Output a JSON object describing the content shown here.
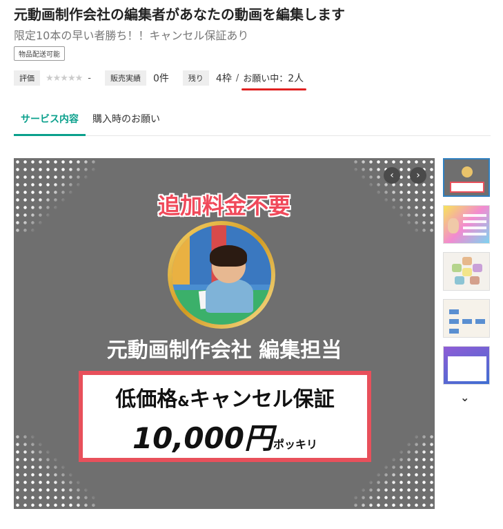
{
  "header": {
    "title": "元動画制作会社の編集者があなたの動画を編集します",
    "subtitle": "限定10本の早い者勝ち！！キャンセル保証あり",
    "badge": "物品配送可能"
  },
  "stats": {
    "rating_label": "評価",
    "rating_stars": "★★★★★",
    "rating_value": "-",
    "sales_label": "販売実績",
    "sales_value": "0件",
    "remaining_label": "残り",
    "remaining_value": "4枠",
    "slash": "/",
    "wish_label": "お願い中：",
    "wish_value": "2人"
  },
  "tabs": [
    {
      "label": "サービス内容",
      "active": true
    },
    {
      "label": "購入時のお願い",
      "active": false
    }
  ],
  "main_image": {
    "headline": "追加料金不要",
    "company_line": "元動画制作会社 編集担当",
    "offer_line1_a": "低価格",
    "offer_line1_amp": "&",
    "offer_line1_b": "キャンセル保証",
    "price": "10,000円",
    "price_suffix": "ポッキリ"
  },
  "carousel": {
    "prev_icon": "‹",
    "next_icon": "›",
    "thumbnail_count": 5,
    "more_icon": "⌄"
  },
  "colors": {
    "accent_green": "#0aa08c",
    "highlight_red": "#e02020",
    "banner_gray": "#6f6f6f",
    "offer_border": "#e8505b"
  }
}
